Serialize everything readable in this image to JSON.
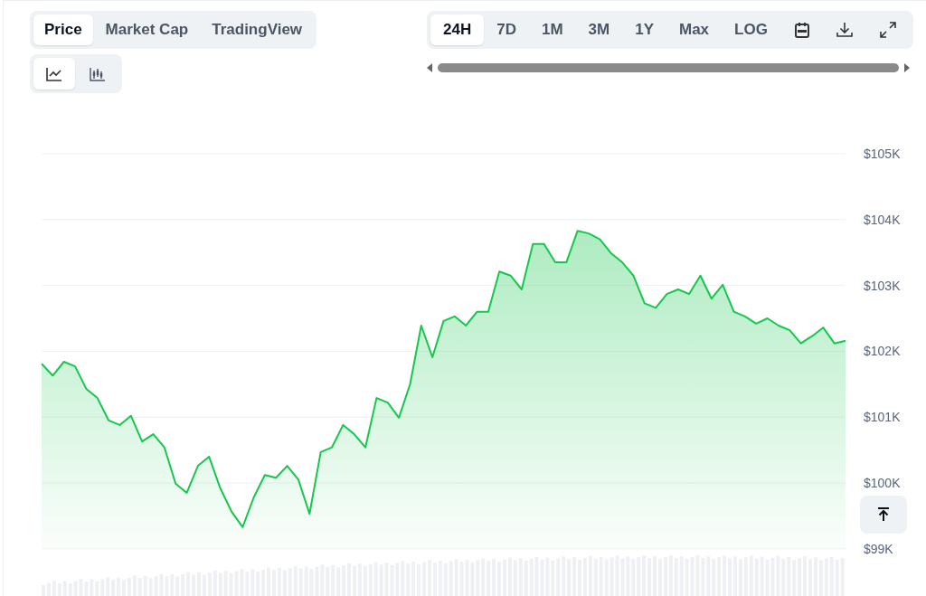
{
  "tabs": [
    {
      "label": "Price",
      "selected": true
    },
    {
      "label": "Market Cap",
      "selected": false
    },
    {
      "label": "TradingView",
      "selected": false
    }
  ],
  "chart_types": [
    {
      "kind": "line",
      "selected": true
    },
    {
      "kind": "candlestick",
      "selected": false
    }
  ],
  "ranges": [
    {
      "label": "24H",
      "selected": true
    },
    {
      "label": "7D",
      "selected": false
    },
    {
      "label": "1M",
      "selected": false
    },
    {
      "label": "3M",
      "selected": false
    },
    {
      "label": "1Y",
      "selected": false
    },
    {
      "label": "Max",
      "selected": false
    },
    {
      "label": "LOG",
      "selected": false
    }
  ],
  "tools": [
    {
      "kind": "calendar"
    },
    {
      "kind": "download"
    },
    {
      "kind": "expand"
    }
  ],
  "chart": {
    "chart_data": {
      "type": "area",
      "grid": true,
      "ylim": [
        99,
        105
      ],
      "yticks": [
        {
          "value": 99,
          "label": "$99K"
        },
        {
          "value": 100,
          "label": "$100K"
        },
        {
          "value": 101,
          "label": "$101K"
        },
        {
          "value": 102,
          "label": "$102K"
        },
        {
          "value": 103,
          "label": "$103K"
        },
        {
          "value": 104,
          "label": "$104K"
        },
        {
          "value": 105,
          "label": "$105K"
        }
      ],
      "series": [
        {
          "color": "#16c74d",
          "values": [
            101.81,
            101.63,
            101.84,
            101.77,
            101.43,
            101.29,
            100.95,
            100.88,
            101.02,
            100.63,
            100.74,
            100.54,
            99.99,
            99.85,
            100.26,
            100.4,
            99.92,
            99.57,
            99.33,
            99.78,
            100.12,
            100.08,
            100.26,
            100.05,
            99.53,
            100.47,
            100.54,
            100.88,
            100.74,
            100.54,
            101.29,
            101.22,
            100.99,
            101.5,
            102.39,
            101.91,
            102.46,
            102.53,
            102.39,
            102.6,
            102.6,
            103.21,
            103.15,
            102.94,
            103.63,
            103.63,
            103.35,
            103.35,
            103.83,
            103.79,
            103.7,
            103.49,
            103.35,
            103.15,
            102.73,
            102.66,
            102.87,
            102.94,
            102.87,
            103.15,
            102.8,
            103.01,
            102.6,
            102.53,
            102.42,
            102.5,
            102.39,
            102.32,
            102.12,
            102.23,
            102.36,
            102.12,
            102.16
          ]
        }
      ]
    }
  }
}
